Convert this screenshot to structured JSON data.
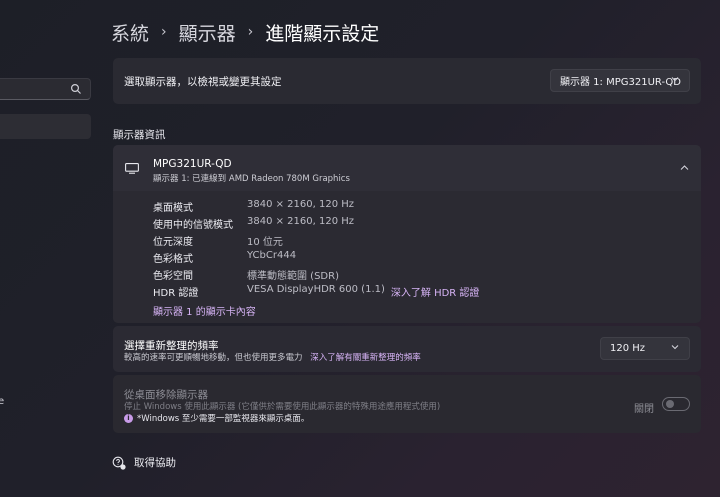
{
  "breadcrumb": {
    "items": [
      "系統",
      "顯示器",
      "進階顯示設定"
    ],
    "separator": "›"
  },
  "display_select": {
    "label": "選取顯示器，以檢視或變更其設定",
    "selected": "顯示器 1: MPG321UR-QD"
  },
  "section_title": "顯示器資訊",
  "monitor": {
    "name": "MPG321UR-QD",
    "subtitle": "顯示器 1: 已連線到 AMD Radeon 780M Graphics",
    "properties": [
      {
        "label": "桌面模式",
        "value": "3840 × 2160, 120 Hz"
      },
      {
        "label": "使用中的信號模式",
        "value": "3840 × 2160, 120 Hz"
      },
      {
        "label": "位元深度",
        "value": "10 位元"
      },
      {
        "label": "色彩格式",
        "value": "YCbCr444"
      },
      {
        "label": "色彩空間",
        "value": "標準動態範圍 (SDR)"
      },
      {
        "label": "HDR 認證",
        "value": "VESA DisplayHDR 600 (1.1)",
        "link": "深入了解 HDR 認證"
      }
    ],
    "adapter_link": "顯示器 1 的顯示卡內容"
  },
  "refresh": {
    "title": "選擇重新整理的頻率",
    "description": "較高的速率可更順暢地移動，但也使用更多電力",
    "link": "深入了解有關重新整理的頻率",
    "selected": "120 Hz"
  },
  "remove_display": {
    "title": "從桌面移除顯示器",
    "description": "停止 Windows 使用此顯示器 (它僅供於需要使用此顯示器的特殊用途應用程式使用)",
    "note": "*Windows 至少需要一部監視器來顯示桌面。",
    "toggle_label": "關閉",
    "toggle_on": false
  },
  "help": {
    "label": "取得協助"
  },
  "sidebar": {
    "fragment": "e"
  },
  "colors": {
    "accent_link": "#d6b3f5",
    "info_dot": "#c89be8",
    "card": "#2a2a32"
  }
}
